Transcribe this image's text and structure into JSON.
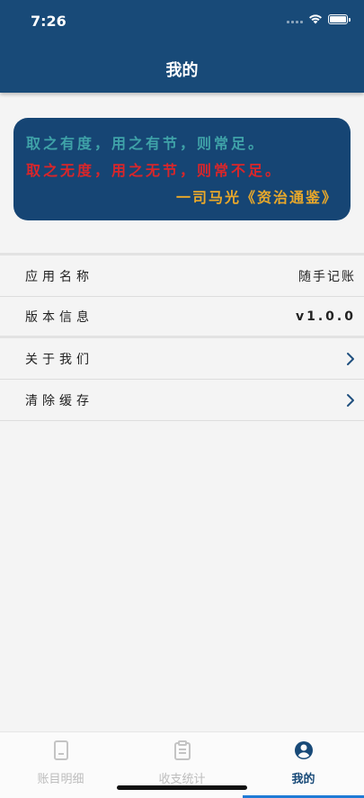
{
  "status_bar": {
    "time": "7:26"
  },
  "header": {
    "title": "我的"
  },
  "quote": {
    "line1": "取之有度，用之有节，则常足。",
    "line2": "取之无度，用之无节，则常不足。",
    "line3": "一司马光《资治通鉴》"
  },
  "info_rows": [
    {
      "label": "应用名称",
      "value": "随手记账"
    },
    {
      "label": "版本信息",
      "value": "v1.0.0"
    }
  ],
  "action_rows": [
    {
      "label": "关于我们"
    },
    {
      "label": "清除缓存"
    }
  ],
  "tabbar": {
    "tabs": [
      {
        "label": "账目明细",
        "icon": "file-icon"
      },
      {
        "label": "收支统计",
        "icon": "clipboard-icon"
      },
      {
        "label": "我的",
        "icon": "user-circle-icon"
      }
    ]
  },
  "colors": {
    "header_bg": "#184a78",
    "quote_bg": "#164574",
    "quote_teal": "#3fa2a8",
    "quote_red": "#d9262a",
    "quote_gold": "#e9a82a",
    "tab_active": "#184a78",
    "tab_inactive": "#bdbdbd"
  }
}
